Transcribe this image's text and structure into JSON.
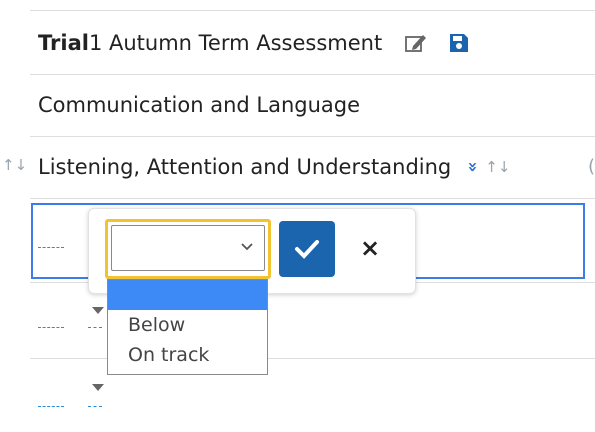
{
  "header": {
    "title_bold": "Trial",
    "title_rest": " 1 Autumn Term Assessment",
    "edit_icon": "edit-icon",
    "save_icon": "save-icon"
  },
  "area": {
    "label": "Communication and Language"
  },
  "aspect": {
    "label": "Listening, Attention and Understanding",
    "expand_glyph": "»",
    "sort_glyph": "↑↓",
    "left_sort_glyph": "↑↓",
    "right_clip_glyph": "("
  },
  "editor": {
    "selected_value": "",
    "chevron": "⌄",
    "confirm_icon": "check-icon",
    "cancel_glyph": "×"
  },
  "dropdown": {
    "options": [
      "",
      "Below",
      "On track"
    ],
    "highlighted_index": 0
  },
  "cells": {
    "empty_marker": "-----"
  },
  "colors": {
    "accent_blue": "#1b64ae",
    "focus_yellow": "#f3c230",
    "selected_option": "#3d8af7",
    "cell_border": "#3d7be8"
  }
}
